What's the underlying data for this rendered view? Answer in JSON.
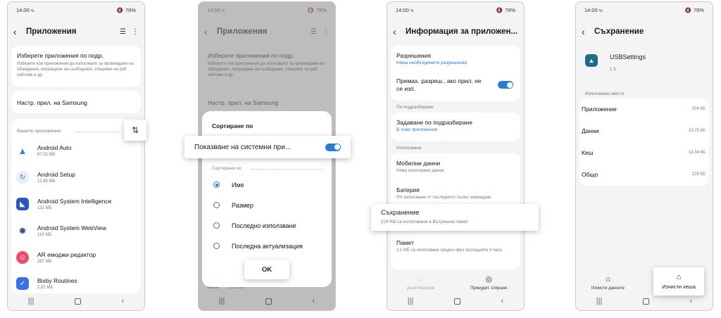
{
  "status": {
    "time": "14:00 ч.",
    "battery": "78%"
  },
  "screen1": {
    "title": "Приложения",
    "choose_title": "Изберете приложения по подр.",
    "choose_desc": "Изберете кои приложения да използвате за провеждане на обаждания, изпращане на съобщения, отваряне на уеб сайтове и др.",
    "samsung_settings": "Настр. прил. на Samsung",
    "your_apps": "Вашите приложения",
    "apps": [
      {
        "name": "Android Auto",
        "size": "67,02 МБ",
        "icon": "android-auto-icon",
        "color": "#2f80ed"
      },
      {
        "name": "Android Setup",
        "size": "12,85 МБ",
        "icon": "android-setup-icon",
        "color": "#4a6fd1"
      },
      {
        "name": "Android System Intelligence",
        "size": "131 МБ",
        "icon": "system-intelligence-icon",
        "color": "#2c59b5"
      },
      {
        "name": "Android System WebView",
        "size": "116 МБ",
        "icon": "webview-icon",
        "color": "#3d5a80"
      },
      {
        "name": "AR емоджи редактор",
        "size": "287 МБ",
        "icon": "ar-emoji-icon",
        "color": "#e8506a"
      },
      {
        "name": "Bixby Routines",
        "size": "2,01 МБ",
        "icon": "bixby-routines-icon",
        "color": "#3d6fe0"
      }
    ]
  },
  "screen2": {
    "title": "Приложения",
    "choose_title": "Изберете приложения по подр.",
    "choose_desc": "Изберете кои приложения да използвате за провеждане на обаждания, изпращане на съобщения, отваряне на уеб сайтове и др.",
    "samsung_settings": "Настр. прил. на Samsung",
    "sheet_title": "Сортиране по",
    "show_system": "Показване на системни при...",
    "sort_by": "Сортиране по",
    "options": [
      "Име",
      "Размер",
      "Последно използване",
      "Последна актуализация"
    ],
    "ok": "OK",
    "behind_size": "2,01 МБ"
  },
  "screen3": {
    "title": "Информация за приложен...",
    "permissions": "Разрешения",
    "permissions_sub": "Няма необходимите разрешения",
    "remove_perm": "Премах. разреш., ако прил. не се изп.",
    "default_section": "По подразбиране",
    "set_default": "Задаване по подразбиране",
    "set_default_sub": "В това приложение",
    "usage_section": "Използване",
    "mobile_data": "Мобилни данни",
    "mobile_data_sub": "Няма използвани данни",
    "battery": "Батерия",
    "battery_sub": "0% използване от последното пълно зареждане",
    "storage": "Съхранение",
    "storage_sub": "229 KB са използвани в Вътрешна памет",
    "memory": "Памет",
    "memory_sub": "2,1 МБ са използвани средно през последните 3 часа",
    "deactivate": "Деактивиране",
    "force_stop": "Принудит. спиране"
  },
  "screen4": {
    "title": "Съхранение",
    "app_name": "USBSettings",
    "version": "1.3",
    "used_section": "Използвано място",
    "rows": [
      {
        "k": "Приложение",
        "v": "204 КБ"
      },
      {
        "k": "Данни",
        "v": "10,75 КБ"
      },
      {
        "k": "Кеш",
        "v": "14,34 КБ"
      },
      {
        "k": "Общо",
        "v": "229 КБ"
      }
    ],
    "clear_data": "Изчисти данните",
    "clear_cache": "Изчисти кеша"
  }
}
